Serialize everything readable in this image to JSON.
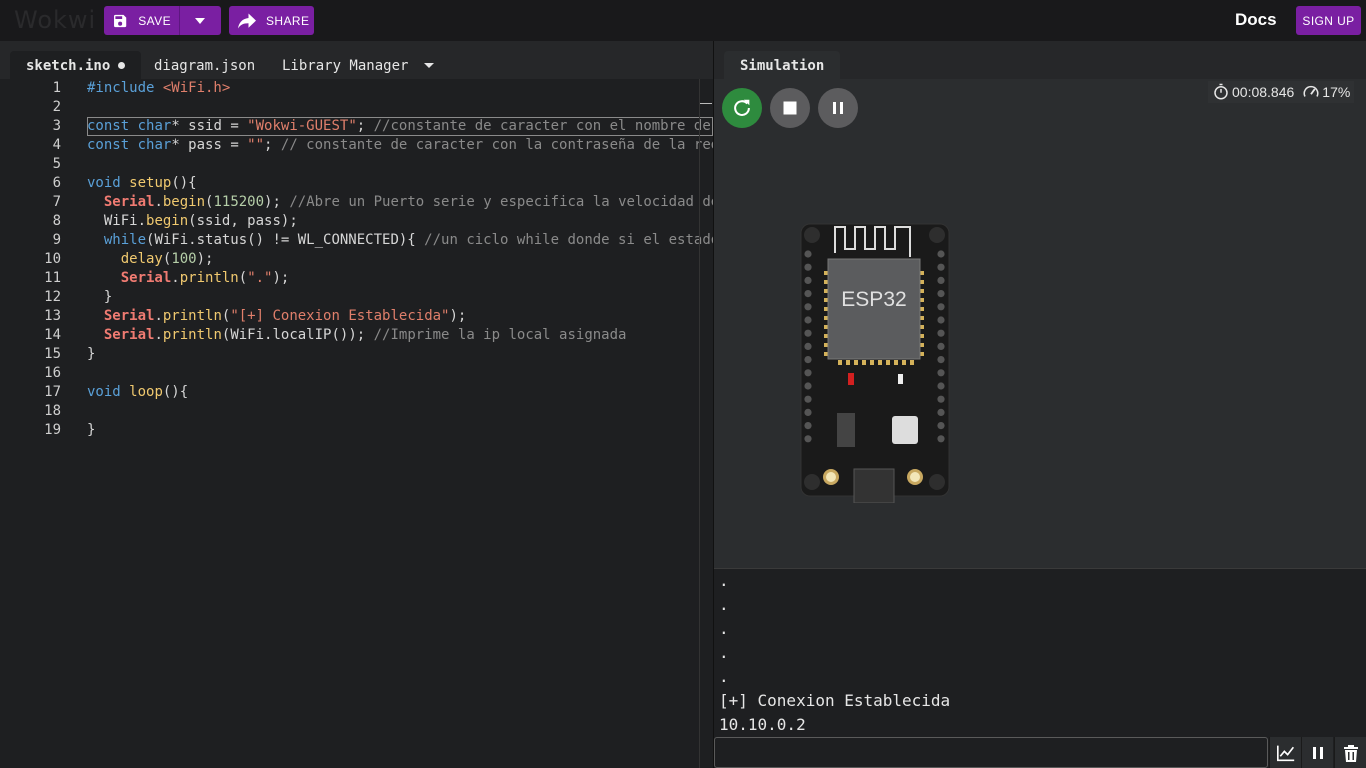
{
  "app": {
    "logo": "Wokwi"
  },
  "toolbar": {
    "save_label": "SAVE",
    "share_label": "SHARE",
    "docs_label": "Docs",
    "signup_label": "SIGN UP"
  },
  "editor": {
    "tabs": [
      {
        "label": "sketch.ino",
        "unsaved": true
      },
      {
        "label": "diagram.json"
      },
      {
        "label": "Library Manager"
      }
    ],
    "line_numbers": [
      "1",
      "2",
      "3",
      "4",
      "5",
      "6",
      "7",
      "8",
      "9",
      "10",
      "11",
      "12",
      "13",
      "14",
      "15",
      "16",
      "17",
      "18",
      "19"
    ],
    "code_lines": [
      "#include <WiFi.h>",
      "",
      "const char* ssid = \"Wokwi-GUEST\"; //constante de caracter con el nombre de",
      "const char* pass = \"\"; // constante de caracter con la contraseña de la red",
      "",
      "void setup(){",
      "  Serial.begin(115200); //Abre un Puerto serie y especifica la velocidad de",
      "  WiFi.begin(ssid, pass);",
      "  while(WiFi.status() != WL_CONNECTED){ //un ciclo while donde si el estado",
      "    delay(100);",
      "    Serial.println(\".\");",
      "  }",
      "  Serial.println(\"[+] Conexion Establecida\");",
      "  Serial.println(WiFi.localIP()); //Imprime la ip local asignada",
      "}",
      "",
      "void loop(){",
      "",
      "}"
    ]
  },
  "simulation": {
    "tab_label": "Simulation",
    "elapsed_time": "00:08.846",
    "speed": "17%",
    "board_label": "ESP32",
    "serial_output": [
      ".",
      ".",
      ".",
      ".",
      ".",
      "[+] Conexion Establecida",
      "10.10.0.2"
    ],
    "serial_input_value": ""
  },
  "icons": {
    "save": "floppy-disk-icon",
    "dropdown": "caret-down-icon",
    "share": "share-arrow-icon",
    "restart": "restart-icon",
    "stop": "stop-icon",
    "pause": "pause-icon",
    "timer": "stopwatch-icon",
    "speed": "speedometer-icon",
    "plotter": "chart-line-icon",
    "serial_pause": "pause-icon",
    "clear": "trash-icon"
  },
  "colors": {
    "accent": "#7a1fa2",
    "restart_green": "#2e8b3e"
  }
}
